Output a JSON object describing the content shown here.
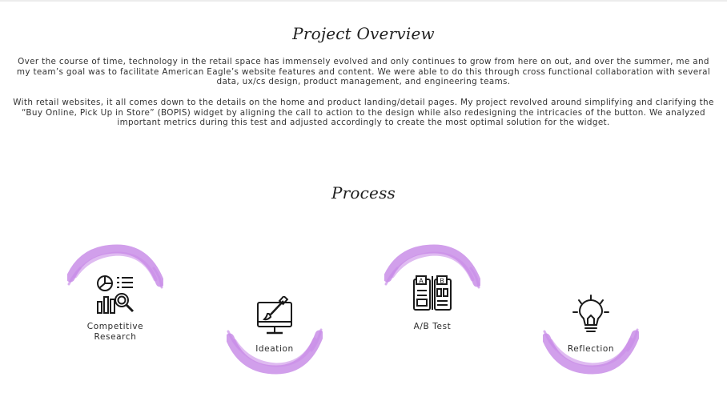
{
  "overview": {
    "title": "Project Overview",
    "paragraph1": "Over the course of time, technology in the retail space has immensely evolved and only continues to grow from here on out, and over the summer, me and my team’s goal was to facilitate American Eagle’s website features and content. We were able to do this through cross functional collaboration with several data, ux/cs design, product management, and engineering teams.",
    "paragraph2": "With retail websites, it all comes down to the details on the home and product landing/detail pages. My project revolved around simplifying and clarifying the “Buy Online, Pick Up in Store” (BOPIS) widget by aligning the call to action to the design while also redesigning the intricacies of the button. We analyzed important metrics during this test and adjusted accordingly to create the most optimal solution for the widget."
  },
  "process": {
    "title": "Process",
    "steps": [
      {
        "label": "Competitive Research",
        "icon": "research-analytics-icon"
      },
      {
        "label": "Ideation",
        "icon": "design-monitor-icon"
      },
      {
        "label": "A/B Test",
        "icon": "ab-test-icon"
      },
      {
        "label": "Reflection",
        "icon": "lightbulb-icon"
      }
    ]
  },
  "colors": {
    "accent_brush": "#c98ee8",
    "text": "#2a2a2a",
    "icon": "#1a1a1a"
  }
}
